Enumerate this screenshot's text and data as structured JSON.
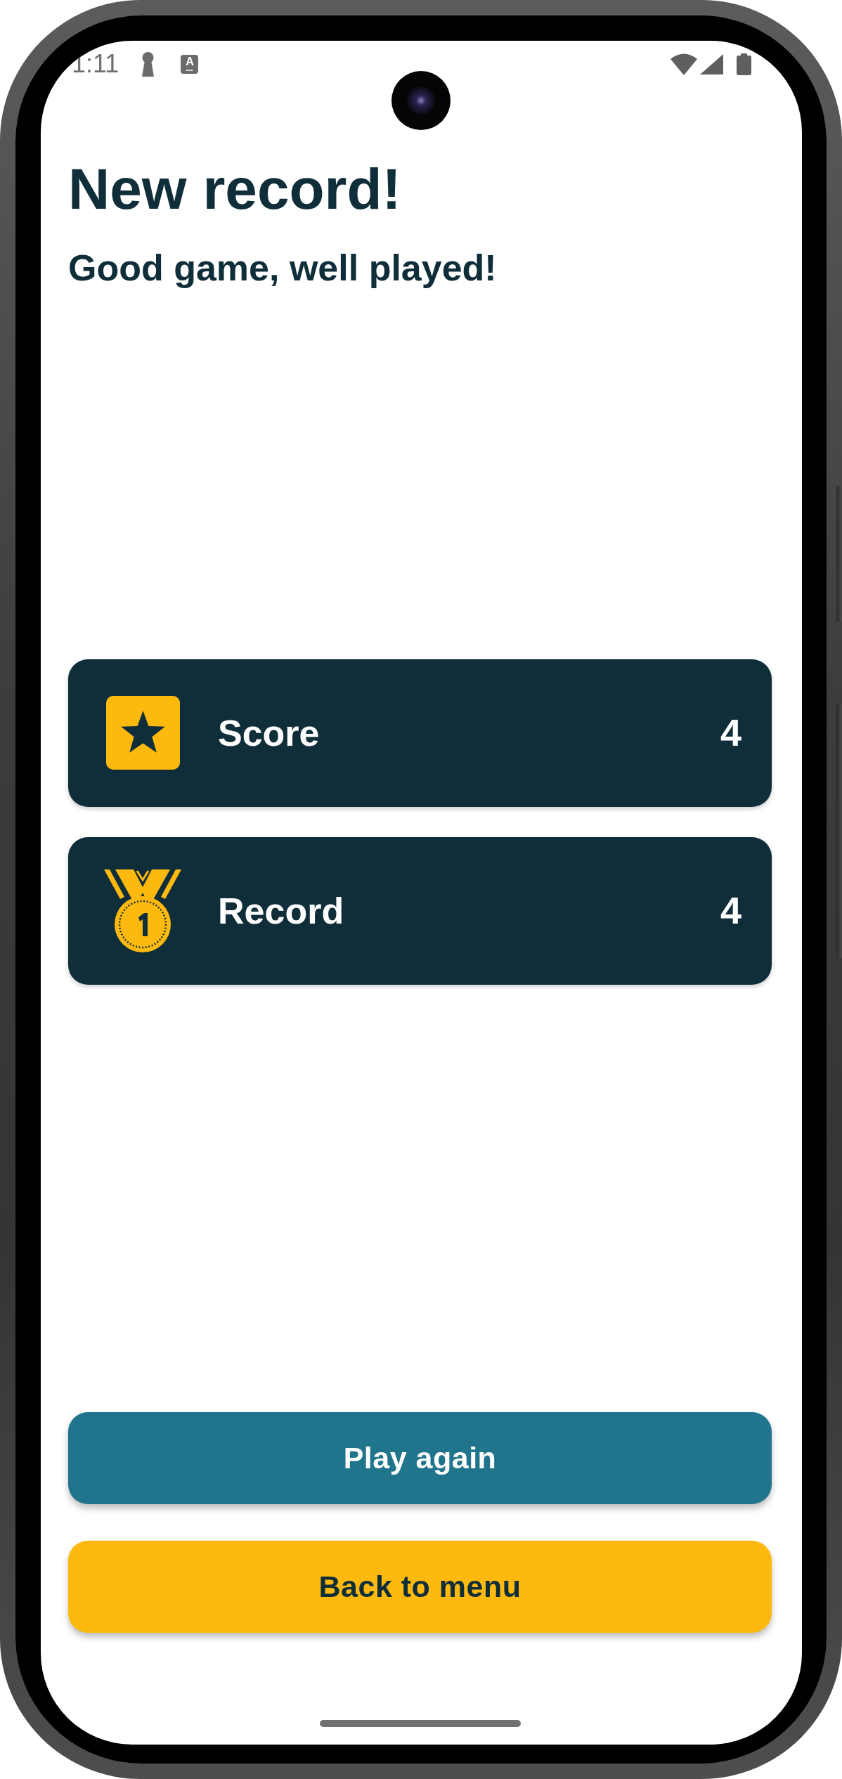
{
  "status_bar": {
    "time": "1:11",
    "badge": "A"
  },
  "heading": {
    "title": "New record!",
    "subtitle": "Good game, well played!"
  },
  "stats": [
    {
      "kind": "score",
      "label": "Score",
      "value": "4"
    },
    {
      "kind": "record",
      "label": "Record",
      "value": "4"
    }
  ],
  "buttons": [
    {
      "kind": "primary",
      "label": "Play again"
    },
    {
      "kind": "secondary",
      "label": "Back to menu"
    }
  ]
}
